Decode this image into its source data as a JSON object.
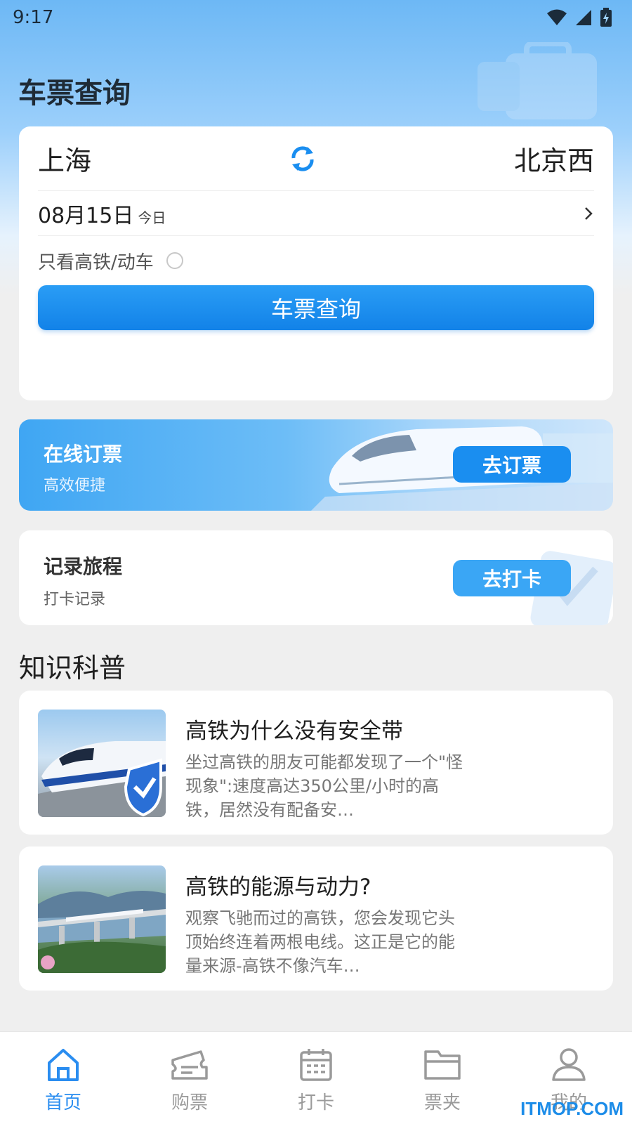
{
  "status": {
    "time": "9:17"
  },
  "page": {
    "title": "车票查询"
  },
  "query": {
    "from": "上海",
    "to": "北京西",
    "date": "08月15日",
    "date_note": "今日",
    "filter_label": "只看高铁/动车",
    "button": "车票查询"
  },
  "booking": {
    "title": "在线订票",
    "subtitle": "高效便捷",
    "button": "去订票"
  },
  "trip": {
    "title": "记录旅程",
    "subtitle": "打卡记录",
    "button": "去打卡"
  },
  "knowledge": {
    "section_title": "知识科普",
    "articles": [
      {
        "title": "高铁为什么没有安全带",
        "excerpt": "坐过高铁的朋友可能都发现了一个\"怪现象\":速度高达350公里/小时的高铁，居然没有配备安…"
      },
      {
        "title": "高铁的能源与动力?",
        "excerpt": "观察飞驰而过的高铁，您会发现它头顶始终连着两根电线。这正是它的能量来源-高铁不像汽车…"
      }
    ]
  },
  "tabs": [
    {
      "label": "首页",
      "icon": "home-icon"
    },
    {
      "label": "购票",
      "icon": "ticket-icon"
    },
    {
      "label": "打卡",
      "icon": "calendar-icon"
    },
    {
      "label": "票夹",
      "icon": "folder-icon"
    },
    {
      "label": "我的",
      "icon": "user-icon"
    }
  ],
  "watermark": "ITMOP.COM",
  "colors": {
    "accent": "#2a8df0",
    "primary_button": "#1a8ef0"
  }
}
